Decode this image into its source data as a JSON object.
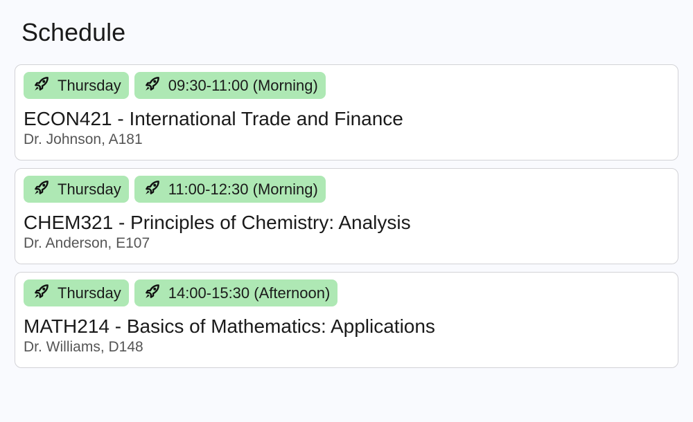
{
  "header": {
    "title": "Schedule"
  },
  "colors": {
    "chip": "#aee8b4"
  },
  "courses": [
    {
      "day": "Thursday",
      "time": "09:30-11:00 (Morning)",
      "title": "ECON421 - International Trade and Finance",
      "details": "Dr. Johnson, A181",
      "icon": "rocket-icon"
    },
    {
      "day": "Thursday",
      "time": "11:00-12:30 (Morning)",
      "title": "CHEM321 - Principles of Chemistry: Analysis",
      "details": "Dr. Anderson, E107",
      "icon": "rocket-icon"
    },
    {
      "day": "Thursday",
      "time": "14:00-15:30 (Afternoon)",
      "title": "MATH214 - Basics of Mathematics: Applications",
      "details": "Dr. Williams, D148",
      "icon": "rocket-icon"
    }
  ]
}
